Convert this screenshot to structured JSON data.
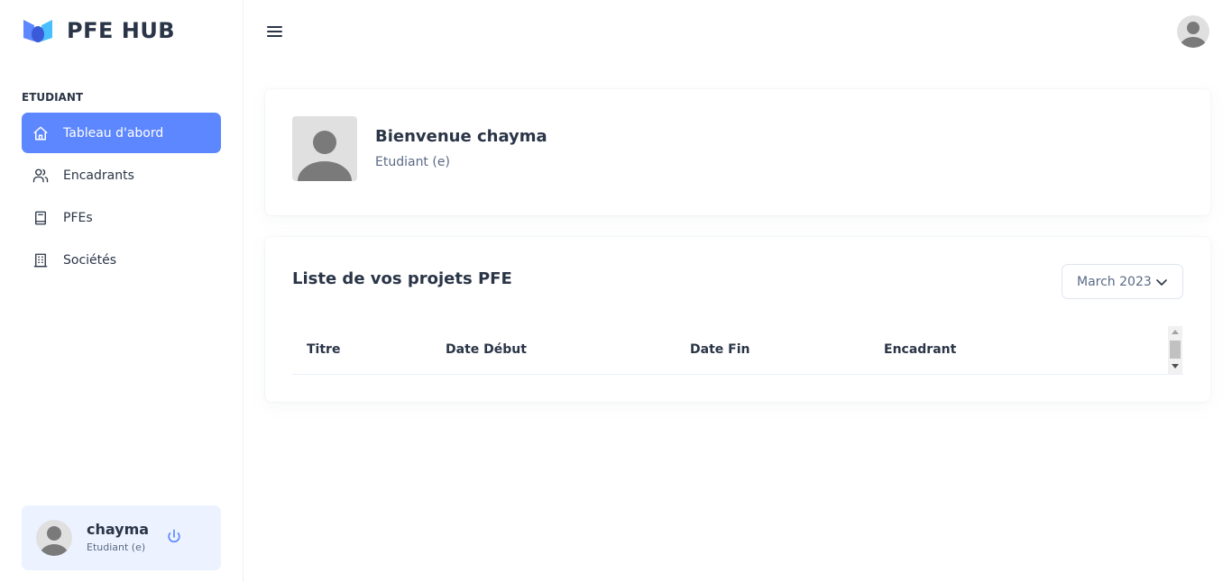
{
  "brand": {
    "name": "PFE HUB"
  },
  "sidebar": {
    "section_title": "ETUDIANT",
    "items": [
      {
        "label": "Tableau d'abord",
        "icon": "home-icon",
        "active": true
      },
      {
        "label": "Encadrants",
        "icon": "users-icon",
        "active": false
      },
      {
        "label": "PFEs",
        "icon": "book-icon",
        "active": false
      },
      {
        "label": "Sociétés",
        "icon": "building-icon",
        "active": false
      }
    ],
    "profile": {
      "name": "chayma",
      "role": "Etudiant (e)"
    }
  },
  "welcome": {
    "title": "Bienvenue chayma",
    "subtitle": "Etudiant (e)"
  },
  "projects": {
    "title": "Liste de vos projets PFE",
    "month_select": "March 2023",
    "columns": [
      "Titre",
      "Date Début",
      "Date Fin",
      "Encadrant"
    ]
  },
  "colors": {
    "accent": "#5d87ff",
    "profile_bg": "#ecf2ff",
    "text": "#2a3547",
    "muted": "#5a6a85"
  }
}
